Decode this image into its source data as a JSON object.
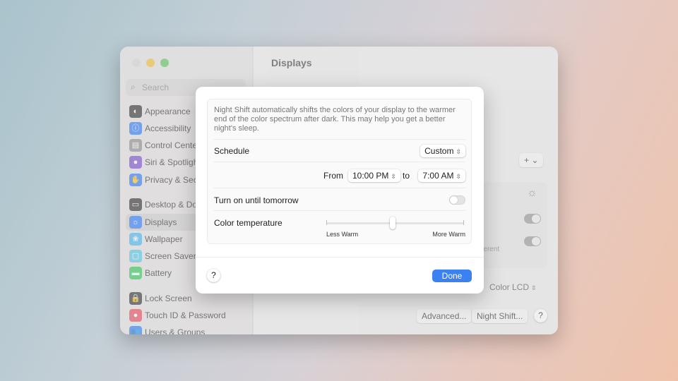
{
  "window": {
    "title": "Displays"
  },
  "sidebar": {
    "search_placeholder": "Search",
    "items": [
      {
        "label": "Appearance",
        "color": "#333333",
        "glyph": "◐"
      },
      {
        "label": "Accessibility",
        "color": "#2f7cf6",
        "glyph": "ⓘ"
      },
      {
        "label": "Control Center",
        "color": "#8e8e93",
        "glyph": "▤"
      },
      {
        "label": "Siri & Spotlight",
        "color": "#7a4fd0",
        "glyph": "●"
      },
      {
        "label": "Privacy & Security",
        "color": "#2f7cf6",
        "glyph": "✋"
      },
      {
        "label": "Desktop & Dock",
        "color": "#333333",
        "glyph": "▭"
      },
      {
        "label": "Displays",
        "color": "#2f7cf6",
        "glyph": "☼"
      },
      {
        "label": "Wallpaper",
        "color": "#49b8f0",
        "glyph": "❀"
      },
      {
        "label": "Screen Saver",
        "color": "#5ac8e8",
        "glyph": "▢"
      },
      {
        "label": "Battery",
        "color": "#34c759",
        "glyph": "▬"
      },
      {
        "label": "Lock Screen",
        "color": "#333333",
        "glyph": "🔒"
      },
      {
        "label": "Touch ID & Password",
        "color": "#e84c5e",
        "glyph": "●"
      },
      {
        "label": "Users & Groups",
        "color": "#2f7cf6",
        "glyph": "👥"
      }
    ],
    "selected": "Displays"
  },
  "main": {
    "add_button": "+ ⌄",
    "partial_text": "fferent",
    "display_select": "Color LCD",
    "advanced_button": "Advanced...",
    "night_shift_button": "Night Shift...",
    "help": "?"
  },
  "dialog": {
    "description": "Night Shift automatically shifts the colors of your display to the warmer end of the color spectrum after dark. This may help you get a better night's sleep.",
    "schedule_label": "Schedule",
    "schedule_value": "Custom",
    "from_label": "From",
    "from_value": "10:00 PM",
    "to_label": "to",
    "to_value": "7:00 AM",
    "turn_on_label": "Turn on until tomorrow",
    "turn_on_state": false,
    "color_temp_label": "Color temperature",
    "color_temp_value": 0.48,
    "less_warm": "Less Warm",
    "more_warm": "More Warm",
    "help": "?",
    "done": "Done",
    "accent": "#3b82f0"
  }
}
